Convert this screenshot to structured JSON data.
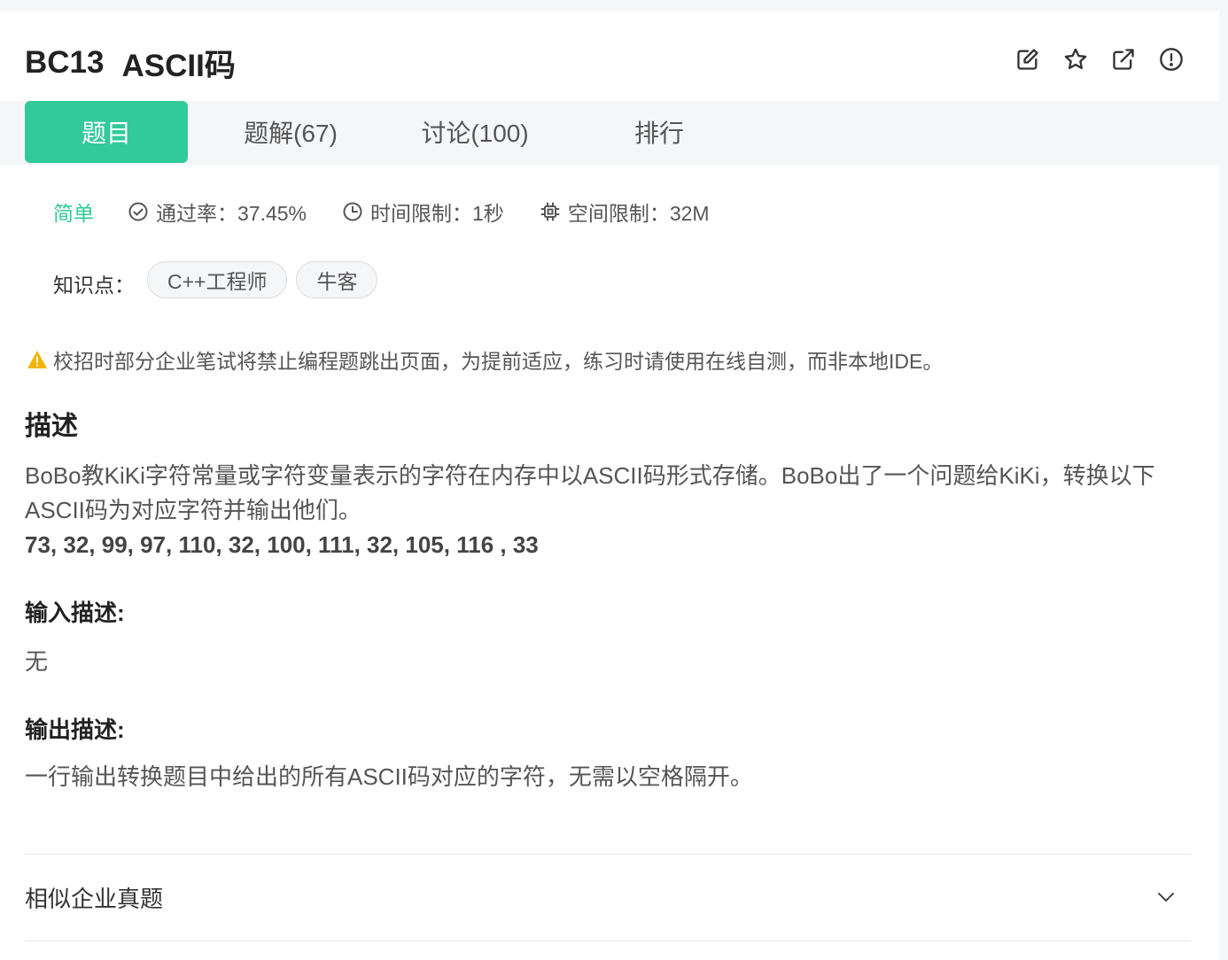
{
  "problem": {
    "code": "BC13",
    "name": "ASCII码"
  },
  "actions": [
    {
      "icon": "edit-icon"
    },
    {
      "icon": "star-icon"
    },
    {
      "icon": "share-icon"
    },
    {
      "icon": "report-icon"
    }
  ],
  "tabs": [
    {
      "label": "题目",
      "active": true
    },
    {
      "label": "题解(67)"
    },
    {
      "label": "讨论(100)"
    },
    {
      "label": "排行"
    }
  ],
  "meta": {
    "difficulty": "简单",
    "pass_rate": "通过率：37.45%",
    "time_limit": "时间限制：1秒",
    "memory_limit": "空间限制：32M"
  },
  "tags": {
    "label": "知识点：",
    "items": [
      "C++工程师",
      "牛客"
    ]
  },
  "notice": "校招时部分企业笔试将禁止编程题跳出页面，为提前适应，练习时请使用在线自测，而非本地IDE。",
  "description": {
    "title": "描述",
    "text": "BoBo教KiKi字符常量或字符变量表示的字符在内存中以ASCII码形式存储。BoBo出了一个问题给KiKi，转换以下ASCII码为对应字符并输出他们。",
    "codes": "73, 32, 99, 97, 110, 32, 100, 111, 32, 105, 116 , 33"
  },
  "input": {
    "title": "输入描述:",
    "text": "无"
  },
  "output": {
    "title": "输出描述:",
    "text": "一行输出转换题目中给出的所有ASCII码对应的字符，无需以空格隔开。"
  },
  "similar": {
    "label": "相似企业真题"
  },
  "colors": {
    "accent": "#32ca99",
    "warning": "#f5b400"
  }
}
